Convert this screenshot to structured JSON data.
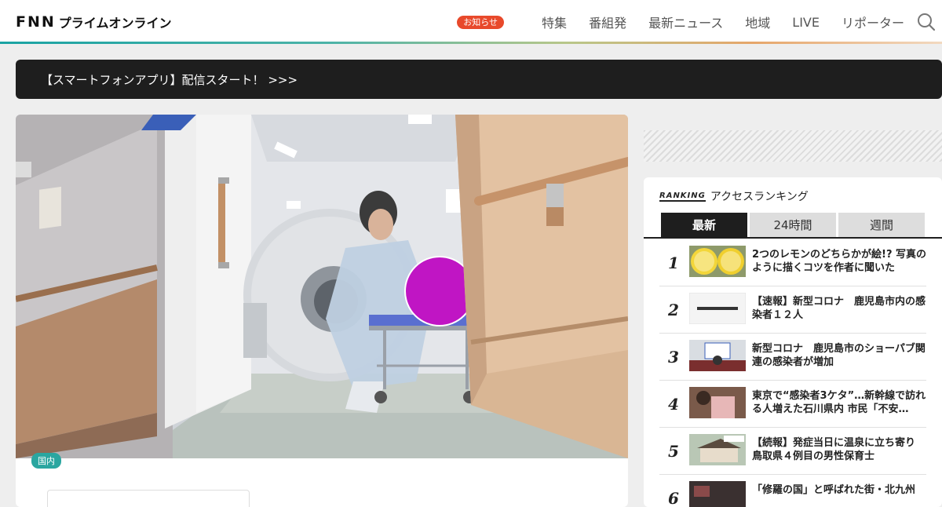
{
  "header": {
    "logo_fnn": "FNN",
    "logo_sub": "プライムオンライン",
    "badge": "お知らせ",
    "nav": [
      "特集",
      "番組発",
      "最新ニュース",
      "地域",
      "LIVE",
      "リポーター"
    ],
    "search_icon": "search-icon"
  },
  "banner": {
    "text": "【スマートフォンアプリ】配信スタート！ >>>"
  },
  "article": {
    "category": "国内",
    "image_icon": "hospital-ct-scan-photo"
  },
  "ranking": {
    "label_en": "RANKING",
    "title": "アクセスランキング",
    "tabs": [
      "最新",
      "24時間",
      "週間"
    ],
    "items": [
      {
        "rank": "1",
        "title": "2つのレモンのどちらかが絵!? 写真のように描くコツを作者に聞いた"
      },
      {
        "rank": "2",
        "title": "【速報】新型コロナ　鹿児島市内の感染者１２人"
      },
      {
        "rank": "3",
        "title": "新型コロナ　鹿児島市のショーパブ関連の感染者が増加"
      },
      {
        "rank": "4",
        "title": "東京で“感染者3ケタ”…新幹線で訪れる人増えた石川県内 市民「不安…"
      },
      {
        "rank": "5",
        "title": "【続報】発症当日に温泉に立ち寄り　鳥取県４例目の男性保育士"
      },
      {
        "rank": "6",
        "title": "「修羅の国」と呼ばれた街・北九州"
      }
    ]
  },
  "colors": {
    "accent_red": "#e8492b",
    "category_teal": "#2aa6a0",
    "dark": "#1e1e1e"
  }
}
